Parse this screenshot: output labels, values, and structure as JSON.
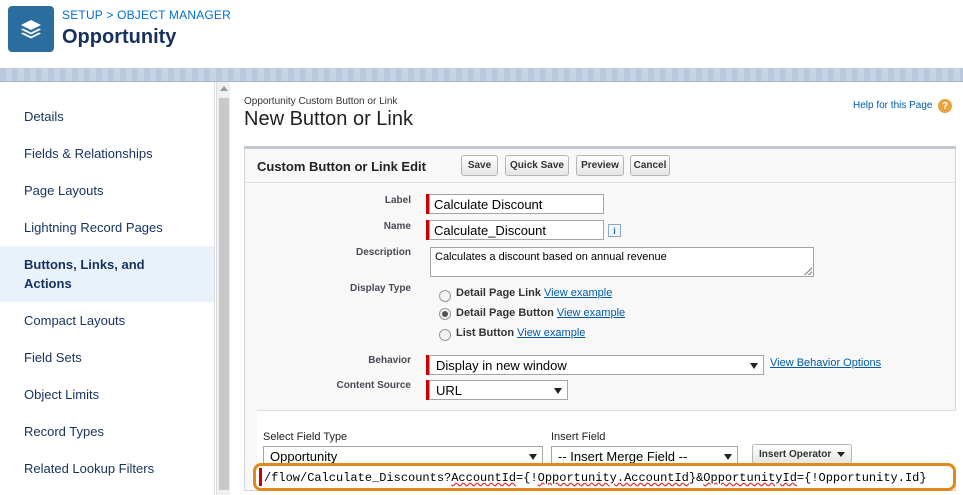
{
  "header": {
    "breadcrumb": "SETUP > OBJECT MANAGER",
    "title": "Opportunity"
  },
  "sidebar": {
    "items": [
      {
        "label": "Details"
      },
      {
        "label": "Fields & Relationships"
      },
      {
        "label": "Page Layouts"
      },
      {
        "label": "Lightning Record Pages"
      },
      {
        "label": "Buttons, Links, and Actions",
        "line1": "Buttons, Links, and",
        "line2": "Actions",
        "active": true
      },
      {
        "label": "Compact Layouts"
      },
      {
        "label": "Field Sets"
      },
      {
        "label": "Object Limits"
      },
      {
        "label": "Record Types"
      },
      {
        "label": "Related Lookup Filters"
      }
    ]
  },
  "main": {
    "subtitle": "Opportunity Custom Button or Link",
    "title": "New Button or Link",
    "help_link": "Help for this Page",
    "help_icon": "?"
  },
  "panel": {
    "title": "Custom Button or Link Edit",
    "buttons": {
      "save": "Save",
      "quick_save": "Quick Save",
      "preview": "Preview",
      "cancel": "Cancel"
    }
  },
  "form": {
    "label_label": "Label",
    "label_value": "Calculate Discount",
    "name_label": "Name",
    "name_value": "Calculate_Discount",
    "info_icon": "i",
    "description_label": "Description",
    "description_value": "Calculates a discount based on annual revenue",
    "display_type_label": "Display Type",
    "display_options": [
      {
        "label": "Detail Page Link",
        "link": "View example",
        "selected": false
      },
      {
        "label": "Detail Page Button",
        "link": "View example",
        "selected": true
      },
      {
        "label": "List Button",
        "link": "View example",
        "selected": false
      }
    ],
    "behavior_label": "Behavior",
    "behavior_value": "Display in new window",
    "behavior_link": "View Behavior Options",
    "content_source_label": "Content Source",
    "content_source_value": "URL"
  },
  "formula": {
    "select_field_type_label": "Select Field Type",
    "select_field_type_value": "Opportunity",
    "insert_field_label": "Insert Field",
    "insert_field_value": "-- Insert Merge Field --",
    "insert_operator": "Insert Operator",
    "url_part1": "/flow/Calculate_Discounts?",
    "url_part2": "AccountId",
    "url_part3": "={!",
    "url_part4": "Opportunity.AccountId",
    "url_part5": "}&",
    "url_part6": "OpportunityId",
    "url_part7": "={!Opportunity.Id}"
  },
  "colors": {
    "accent": "#0070d2",
    "highlight_border": "#e08a1e",
    "required": "#cc0000"
  }
}
